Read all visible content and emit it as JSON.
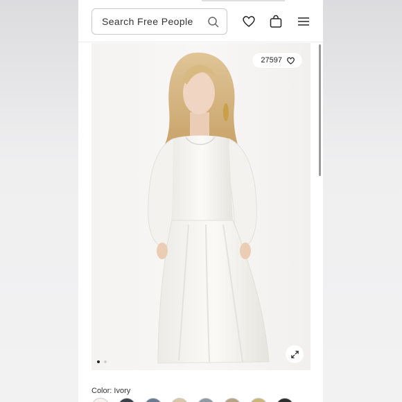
{
  "header": {
    "search_placeholder": "Search Free People",
    "icons": [
      "search-icon",
      "heart-icon",
      "bag-icon",
      "menu-icon"
    ]
  },
  "product_image": {
    "likes": "27597",
    "active_slide": 1,
    "slides": 2
  },
  "color": {
    "label": "Color: Ivory",
    "swatch_count": 8
  }
}
